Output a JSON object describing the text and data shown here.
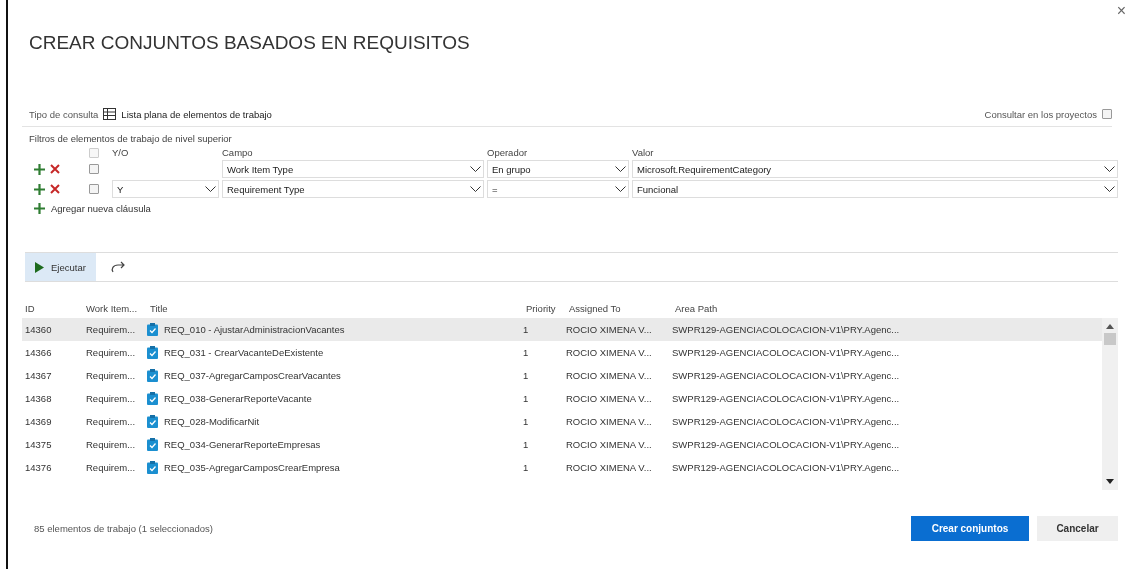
{
  "dialog": {
    "title": "CREAR CONJUNTOS BASADOS EN REQUISITOS",
    "close": "×"
  },
  "query_type": {
    "label": "Tipo de consulta",
    "value": "Lista plana de elementos de trabajo"
  },
  "cross_project": {
    "label": "Consultar en los proyectos",
    "checked": false
  },
  "filters": {
    "label": "Filtros de elementos de trabajo de nivel superior",
    "columns": [
      "Y/O",
      "Campo",
      "Operador",
      "Valor"
    ],
    "header_checkbox_disabled": true,
    "rows": [
      {
        "checked": false,
        "field": "Work Item Type",
        "operator": "En grupo",
        "value": "Microsoft.RequirementCategory"
      },
      {
        "checked": false,
        "and_or": "Y",
        "field": "Requirement Type",
        "operator": "=",
        "value": "Funcional"
      }
    ],
    "add_label": "Agregar nueva cláusula"
  },
  "toolbar": {
    "run": {
      "label": "Ejecutar",
      "active": true
    }
  },
  "table": {
    "columns": [
      "ID",
      "Work Item...",
      "Title",
      "Priority",
      "Assigned To",
      "Area Path"
    ],
    "rows": [
      {
        "id": "14360",
        "type": "Requirem...",
        "title": "REQ_010 - AjustarAdministracionVacantes",
        "priority": "1",
        "assigned": "ROCIO XIMENA V...",
        "area": "SWPR129-AGENCIACOLOCACION-V1\\PRY.Agenc...",
        "selected": true
      },
      {
        "id": "14366",
        "type": "Requirem...",
        "title": "REQ_031 - CrearVacanteDeExistente",
        "priority": "1",
        "assigned": "ROCIO XIMENA V...",
        "area": "SWPR129-AGENCIACOLOCACION-V1\\PRY.Agenc...",
        "selected": false
      },
      {
        "id": "14367",
        "type": "Requirem...",
        "title": "REQ_037-AgregarCamposCrearVacantes",
        "priority": "1",
        "assigned": "ROCIO XIMENA V...",
        "area": "SWPR129-AGENCIACOLOCACION-V1\\PRY.Agenc...",
        "selected": false
      },
      {
        "id": "14368",
        "type": "Requirem...",
        "title": "REQ_038-GenerarReporteVacante",
        "priority": "1",
        "assigned": "ROCIO XIMENA V...",
        "area": "SWPR129-AGENCIACOLOCACION-V1\\PRY.Agenc...",
        "selected": false
      },
      {
        "id": "14369",
        "type": "Requirem...",
        "title": "REQ_028-ModificarNit",
        "priority": "1",
        "assigned": "ROCIO XIMENA V...",
        "area": "SWPR129-AGENCIACOLOCACION-V1\\PRY.Agenc...",
        "selected": false
      },
      {
        "id": "14375",
        "type": "Requirem...",
        "title": "REQ_034-GenerarReporteEmpresas",
        "priority": "1",
        "assigned": "ROCIO XIMENA V...",
        "area": "SWPR129-AGENCIACOLOCACION-V1\\PRY.Agenc...",
        "selected": false
      },
      {
        "id": "14376",
        "type": "Requirem...",
        "title": "REQ_035-AgregarCamposCrearEmpresa",
        "priority": "1",
        "assigned": "ROCIO XIMENA V...",
        "area": "SWPR129-AGENCIACOLOCACION-V1\\PRY.Agenc...",
        "selected": false
      }
    ]
  },
  "status": "85 elementos de trabajo (1 seleccionados)",
  "buttons": [
    {
      "label": "Crear conjuntos",
      "kind": "primary"
    },
    {
      "label": "Cancelar",
      "kind": "secondary"
    }
  ]
}
